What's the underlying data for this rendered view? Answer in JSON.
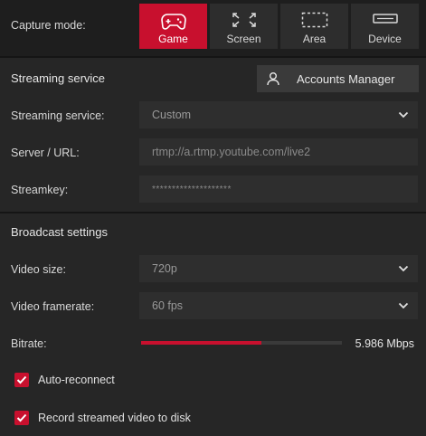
{
  "capture": {
    "label": "Capture mode:",
    "modes": [
      {
        "label": "Game",
        "icon": "gamepad-icon",
        "active": true
      },
      {
        "label": "Screen",
        "icon": "fullscreen-icon",
        "active": false
      },
      {
        "label": "Area",
        "icon": "area-icon",
        "active": false
      },
      {
        "label": "Device",
        "icon": "device-icon",
        "active": false
      }
    ]
  },
  "streaming": {
    "title": "Streaming service",
    "accounts_button": "Accounts Manager",
    "service_label": "Streaming service:",
    "service_value": "Custom",
    "server_label": "Server / URL:",
    "server_value": "rtmp://a.rtmp.youtube.com/live2",
    "streamkey_label": "Streamkey:",
    "streamkey_value": "********************"
  },
  "broadcast": {
    "title": "Broadcast settings",
    "video_size_label": "Video size:",
    "video_size_value": "720p",
    "framerate_label": "Video framerate:",
    "framerate_value": "60 fps",
    "bitrate_label": "Bitrate:",
    "bitrate_value": "5.986 Mbps",
    "bitrate_fraction": 0.6,
    "auto_reconnect_label": "Auto-reconnect",
    "auto_reconnect_checked": true,
    "record_label": "Record streamed video to disk",
    "record_checked": true
  },
  "colors": {
    "accent": "#c8102e",
    "background": "#1e1e1e",
    "field": "#2e2e2e"
  }
}
